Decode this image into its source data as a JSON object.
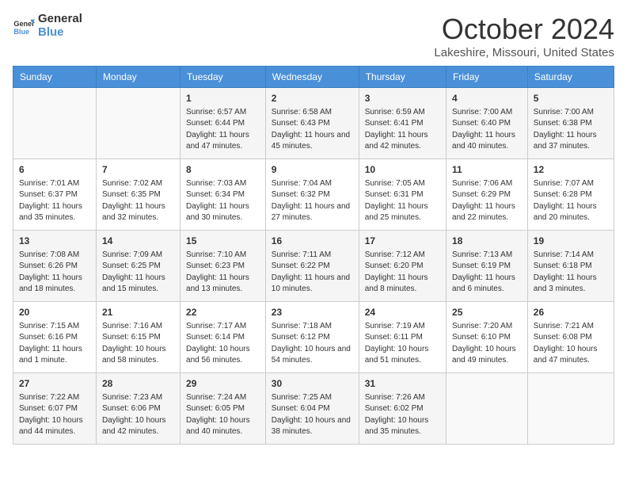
{
  "header": {
    "logo_line1": "General",
    "logo_line2": "Blue",
    "month_title": "October 2024",
    "location": "Lakeshire, Missouri, United States"
  },
  "days_of_week": [
    "Sunday",
    "Monday",
    "Tuesday",
    "Wednesday",
    "Thursday",
    "Friday",
    "Saturday"
  ],
  "weeks": [
    [
      {
        "day": "",
        "sunrise": "",
        "sunset": "",
        "daylight": ""
      },
      {
        "day": "",
        "sunrise": "",
        "sunset": "",
        "daylight": ""
      },
      {
        "day": "1",
        "sunrise": "Sunrise: 6:57 AM",
        "sunset": "Sunset: 6:44 PM",
        "daylight": "Daylight: 11 hours and 47 minutes."
      },
      {
        "day": "2",
        "sunrise": "Sunrise: 6:58 AM",
        "sunset": "Sunset: 6:43 PM",
        "daylight": "Daylight: 11 hours and 45 minutes."
      },
      {
        "day": "3",
        "sunrise": "Sunrise: 6:59 AM",
        "sunset": "Sunset: 6:41 PM",
        "daylight": "Daylight: 11 hours and 42 minutes."
      },
      {
        "day": "4",
        "sunrise": "Sunrise: 7:00 AM",
        "sunset": "Sunset: 6:40 PM",
        "daylight": "Daylight: 11 hours and 40 minutes."
      },
      {
        "day": "5",
        "sunrise": "Sunrise: 7:00 AM",
        "sunset": "Sunset: 6:38 PM",
        "daylight": "Daylight: 11 hours and 37 minutes."
      }
    ],
    [
      {
        "day": "6",
        "sunrise": "Sunrise: 7:01 AM",
        "sunset": "Sunset: 6:37 PM",
        "daylight": "Daylight: 11 hours and 35 minutes."
      },
      {
        "day": "7",
        "sunrise": "Sunrise: 7:02 AM",
        "sunset": "Sunset: 6:35 PM",
        "daylight": "Daylight: 11 hours and 32 minutes."
      },
      {
        "day": "8",
        "sunrise": "Sunrise: 7:03 AM",
        "sunset": "Sunset: 6:34 PM",
        "daylight": "Daylight: 11 hours and 30 minutes."
      },
      {
        "day": "9",
        "sunrise": "Sunrise: 7:04 AM",
        "sunset": "Sunset: 6:32 PM",
        "daylight": "Daylight: 11 hours and 27 minutes."
      },
      {
        "day": "10",
        "sunrise": "Sunrise: 7:05 AM",
        "sunset": "Sunset: 6:31 PM",
        "daylight": "Daylight: 11 hours and 25 minutes."
      },
      {
        "day": "11",
        "sunrise": "Sunrise: 7:06 AM",
        "sunset": "Sunset: 6:29 PM",
        "daylight": "Daylight: 11 hours and 22 minutes."
      },
      {
        "day": "12",
        "sunrise": "Sunrise: 7:07 AM",
        "sunset": "Sunset: 6:28 PM",
        "daylight": "Daylight: 11 hours and 20 minutes."
      }
    ],
    [
      {
        "day": "13",
        "sunrise": "Sunrise: 7:08 AM",
        "sunset": "Sunset: 6:26 PM",
        "daylight": "Daylight: 11 hours and 18 minutes."
      },
      {
        "day": "14",
        "sunrise": "Sunrise: 7:09 AM",
        "sunset": "Sunset: 6:25 PM",
        "daylight": "Daylight: 11 hours and 15 minutes."
      },
      {
        "day": "15",
        "sunrise": "Sunrise: 7:10 AM",
        "sunset": "Sunset: 6:23 PM",
        "daylight": "Daylight: 11 hours and 13 minutes."
      },
      {
        "day": "16",
        "sunrise": "Sunrise: 7:11 AM",
        "sunset": "Sunset: 6:22 PM",
        "daylight": "Daylight: 11 hours and 10 minutes."
      },
      {
        "day": "17",
        "sunrise": "Sunrise: 7:12 AM",
        "sunset": "Sunset: 6:20 PM",
        "daylight": "Daylight: 11 hours and 8 minutes."
      },
      {
        "day": "18",
        "sunrise": "Sunrise: 7:13 AM",
        "sunset": "Sunset: 6:19 PM",
        "daylight": "Daylight: 11 hours and 6 minutes."
      },
      {
        "day": "19",
        "sunrise": "Sunrise: 7:14 AM",
        "sunset": "Sunset: 6:18 PM",
        "daylight": "Daylight: 11 hours and 3 minutes."
      }
    ],
    [
      {
        "day": "20",
        "sunrise": "Sunrise: 7:15 AM",
        "sunset": "Sunset: 6:16 PM",
        "daylight": "Daylight: 11 hours and 1 minute."
      },
      {
        "day": "21",
        "sunrise": "Sunrise: 7:16 AM",
        "sunset": "Sunset: 6:15 PM",
        "daylight": "Daylight: 10 hours and 58 minutes."
      },
      {
        "day": "22",
        "sunrise": "Sunrise: 7:17 AM",
        "sunset": "Sunset: 6:14 PM",
        "daylight": "Daylight: 10 hours and 56 minutes."
      },
      {
        "day": "23",
        "sunrise": "Sunrise: 7:18 AM",
        "sunset": "Sunset: 6:12 PM",
        "daylight": "Daylight: 10 hours and 54 minutes."
      },
      {
        "day": "24",
        "sunrise": "Sunrise: 7:19 AM",
        "sunset": "Sunset: 6:11 PM",
        "daylight": "Daylight: 10 hours and 51 minutes."
      },
      {
        "day": "25",
        "sunrise": "Sunrise: 7:20 AM",
        "sunset": "Sunset: 6:10 PM",
        "daylight": "Daylight: 10 hours and 49 minutes."
      },
      {
        "day": "26",
        "sunrise": "Sunrise: 7:21 AM",
        "sunset": "Sunset: 6:08 PM",
        "daylight": "Daylight: 10 hours and 47 minutes."
      }
    ],
    [
      {
        "day": "27",
        "sunrise": "Sunrise: 7:22 AM",
        "sunset": "Sunset: 6:07 PM",
        "daylight": "Daylight: 10 hours and 44 minutes."
      },
      {
        "day": "28",
        "sunrise": "Sunrise: 7:23 AM",
        "sunset": "Sunset: 6:06 PM",
        "daylight": "Daylight: 10 hours and 42 minutes."
      },
      {
        "day": "29",
        "sunrise": "Sunrise: 7:24 AM",
        "sunset": "Sunset: 6:05 PM",
        "daylight": "Daylight: 10 hours and 40 minutes."
      },
      {
        "day": "30",
        "sunrise": "Sunrise: 7:25 AM",
        "sunset": "Sunset: 6:04 PM",
        "daylight": "Daylight: 10 hours and 38 minutes."
      },
      {
        "day": "31",
        "sunrise": "Sunrise: 7:26 AM",
        "sunset": "Sunset: 6:02 PM",
        "daylight": "Daylight: 10 hours and 35 minutes."
      },
      {
        "day": "",
        "sunrise": "",
        "sunset": "",
        "daylight": ""
      },
      {
        "day": "",
        "sunrise": "",
        "sunset": "",
        "daylight": ""
      }
    ]
  ]
}
